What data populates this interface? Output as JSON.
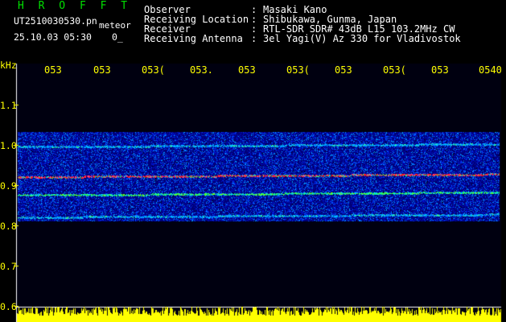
{
  "header": {
    "brand": "H R O F F T",
    "filename": "UT2510030530.pn",
    "type_label": "meteor",
    "timestamp": "25.10.03 05:30",
    "count": "0_"
  },
  "info": [
    {
      "label": "Observer",
      "value": "Masaki Kano"
    },
    {
      "label": "Receiving Location",
      "value": "Shibukawa, Gunma, Japan"
    },
    {
      "label": "Receiver",
      "value": "RTL-SDR SDR# 43dB L15 103.2MHz CW"
    },
    {
      "label": "Receiving Antenna",
      "value": "3el Yagi(V) Az 330 for Vladivostok"
    }
  ],
  "info_sep": ":",
  "x_ticks": [
    "053",
    "053",
    "053(",
    "053.",
    "053",
    "053(",
    "053",
    "053(",
    "053",
    "0540"
  ],
  "y_unit": "kHz",
  "y_ticks": [
    "1.1",
    "1.0",
    "0.9",
    "0.8",
    "0.7",
    "0.6"
  ],
  "colors": {
    "label": "#ffff00",
    "brand": "#00e000",
    "amplitude": "#ffff00"
  },
  "chart_data": {
    "type": "heatmap",
    "ylabel": "kHz",
    "ylim": [
      0.6,
      1.1
    ],
    "band": [
      0.81,
      1.03
    ],
    "lines": [
      {
        "freq": 0.92,
        "intensity": "high"
      },
      {
        "freq": 0.875,
        "intensity": "medium"
      },
      {
        "freq": 0.82,
        "intensity": "low"
      },
      {
        "freq": 0.995,
        "intensity": "low"
      }
    ]
  }
}
